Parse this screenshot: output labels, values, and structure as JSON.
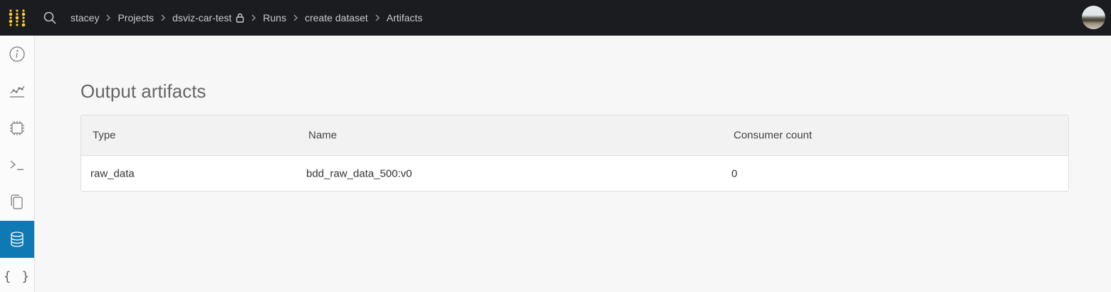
{
  "topbar": {
    "breadcrumbs": [
      {
        "label": "stacey"
      },
      {
        "label": "Projects"
      },
      {
        "label": "dsviz-car-test",
        "locked": true
      },
      {
        "label": "Runs"
      },
      {
        "label": "create dataset"
      },
      {
        "label": "Artifacts"
      }
    ]
  },
  "sidebar": {
    "items": [
      {
        "icon": "info-icon"
      },
      {
        "icon": "chart-icon"
      },
      {
        "icon": "cpu-icon"
      },
      {
        "icon": "terminal-icon"
      },
      {
        "icon": "files-icon"
      },
      {
        "icon": "database-icon",
        "active": true
      },
      {
        "icon": "braces-icon",
        "text": "{ }"
      }
    ]
  },
  "main": {
    "title": "Output artifacts",
    "table": {
      "headers": [
        "Type",
        "Name",
        "Consumer count"
      ],
      "rows": [
        {
          "type": "raw_data",
          "name": "bdd_raw_data_500:v0",
          "consumers": "0"
        }
      ]
    }
  },
  "colors": {
    "topbar_bg": "#1a1c1f",
    "active_nav": "#0e79b2",
    "logo": "#ffcc33"
  }
}
